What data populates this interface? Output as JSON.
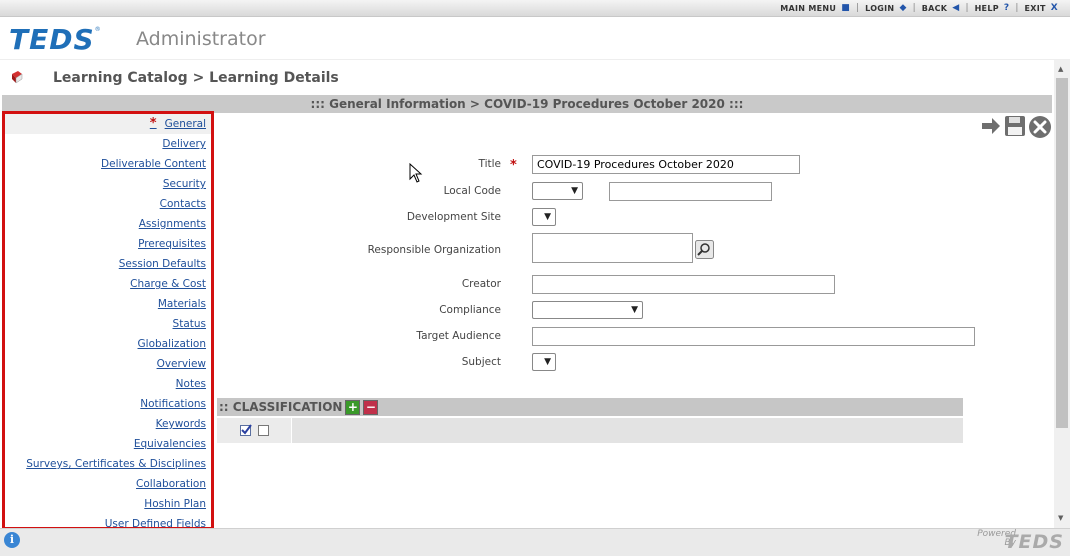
{
  "topnav": {
    "items": [
      {
        "label": "MAIN MENU",
        "icon": "square-icon"
      },
      {
        "label": "LOGIN",
        "icon": "diamond-icon"
      },
      {
        "label": "BACK",
        "icon": "back-arrow-icon"
      },
      {
        "label": "HELP",
        "icon": "question-icon"
      },
      {
        "label": "EXIT",
        "icon": "close-x-icon"
      }
    ],
    "glyphs": [
      "■",
      "◆",
      "◀",
      "?",
      "X"
    ]
  },
  "header": {
    "logo_text": "TEDS",
    "logo_reg": "®",
    "app_name": "Administrator"
  },
  "breadcrumb": {
    "text": "Learning Catalog > Learning Details"
  },
  "section_header": ":::  General Information > COVID-19 Procedures October 2020  :::",
  "leftnav": {
    "required_mark": "*",
    "items": [
      "General",
      "Delivery",
      "Deliverable Content",
      "Security",
      "Contacts",
      "Assignments",
      "Prerequisites",
      "Session Defaults",
      "Charge & Cost",
      "Materials",
      "Status",
      "Globalization",
      "Overview",
      "Notes",
      "Notifications",
      "Keywords",
      "Equivalencies",
      "Surveys, Certificates & Disciplines",
      "Collaboration",
      "Hoshin Plan",
      "User Defined Fields"
    ]
  },
  "form": {
    "title_label": "Title",
    "title_value": "COVID-19 Procedures October 2020",
    "required_mark": "*",
    "local_code_label": "Local Code",
    "local_code_value": "",
    "development_site_label": "Development Site",
    "responsible_org_label": "Responsible Organization",
    "creator_label": "Creator",
    "creator_value": "",
    "compliance_label": "Compliance",
    "target_audience_label": "Target Audience",
    "target_audience_value": "",
    "subject_label": "Subject"
  },
  "classification": {
    "title": ":: CLASSIFICATION",
    "add_glyph": "+",
    "remove_glyph": "−"
  },
  "footer": {
    "powered_line1": "Powered",
    "powered_line2": "By",
    "brand": "TEDS",
    "info_glyph": "i"
  },
  "colors": {
    "brand_blue": "#1f6fb8",
    "nav_highlight_border": "#d21010",
    "link_blue": "#1f4f9a",
    "required_red": "#c01010"
  }
}
